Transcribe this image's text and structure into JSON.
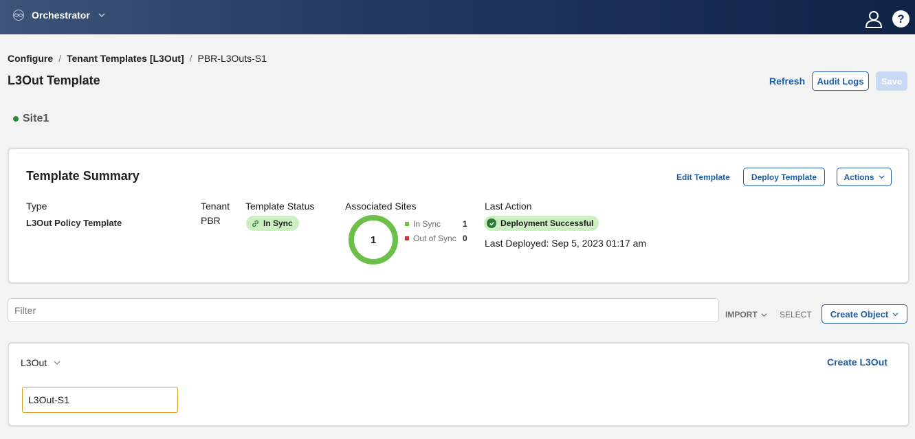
{
  "app": {
    "name": "Orchestrator"
  },
  "breadcrumb": {
    "items": [
      "Configure",
      "Tenant Templates [L3Out]",
      "PBR-L3Outs-S1"
    ],
    "separator": "/"
  },
  "page": {
    "title": "L3Out Template"
  },
  "toolbar": {
    "refresh_label": "Refresh",
    "audit_label": "Audit Logs",
    "save_label": "Save"
  },
  "site": {
    "name": "Site1",
    "status_color": "#2f8a3b"
  },
  "summary": {
    "title": "Template Summary",
    "edit_label": "Edit Template",
    "deploy_label": "Deploy Template",
    "actions_label": "Actions",
    "type_label": "Type",
    "type_value": "L3Out Policy Template",
    "tenant_label": "Tenant",
    "tenant_value": "PBR",
    "status_label": "Template Status",
    "status_value": "In Sync",
    "sites_label": "Associated Sites",
    "sites_total": "1",
    "legend": [
      {
        "label": "In Sync",
        "count": "1",
        "color": "#6cc04a"
      },
      {
        "label": "Out of Sync",
        "count": "0",
        "color": "#d32f2f"
      }
    ],
    "last_action_label": "Last Action",
    "last_action_value": "Deployment Successful",
    "last_deployed": "Last Deployed: Sep 5, 2023 01:17 am"
  },
  "filter": {
    "placeholder": "Filter",
    "import_label": "IMPORT",
    "select_label": "SELECT",
    "create_label": "Create Object"
  },
  "l3out": {
    "section_label": "L3Out",
    "create_label": "Create L3Out",
    "items": [
      "L3Out-S1"
    ]
  },
  "colors": {
    "accent": "#1f5ca3",
    "success": "#2d7a36",
    "pill_bg": "#cbefc2",
    "header_dark": "#0f2347"
  }
}
